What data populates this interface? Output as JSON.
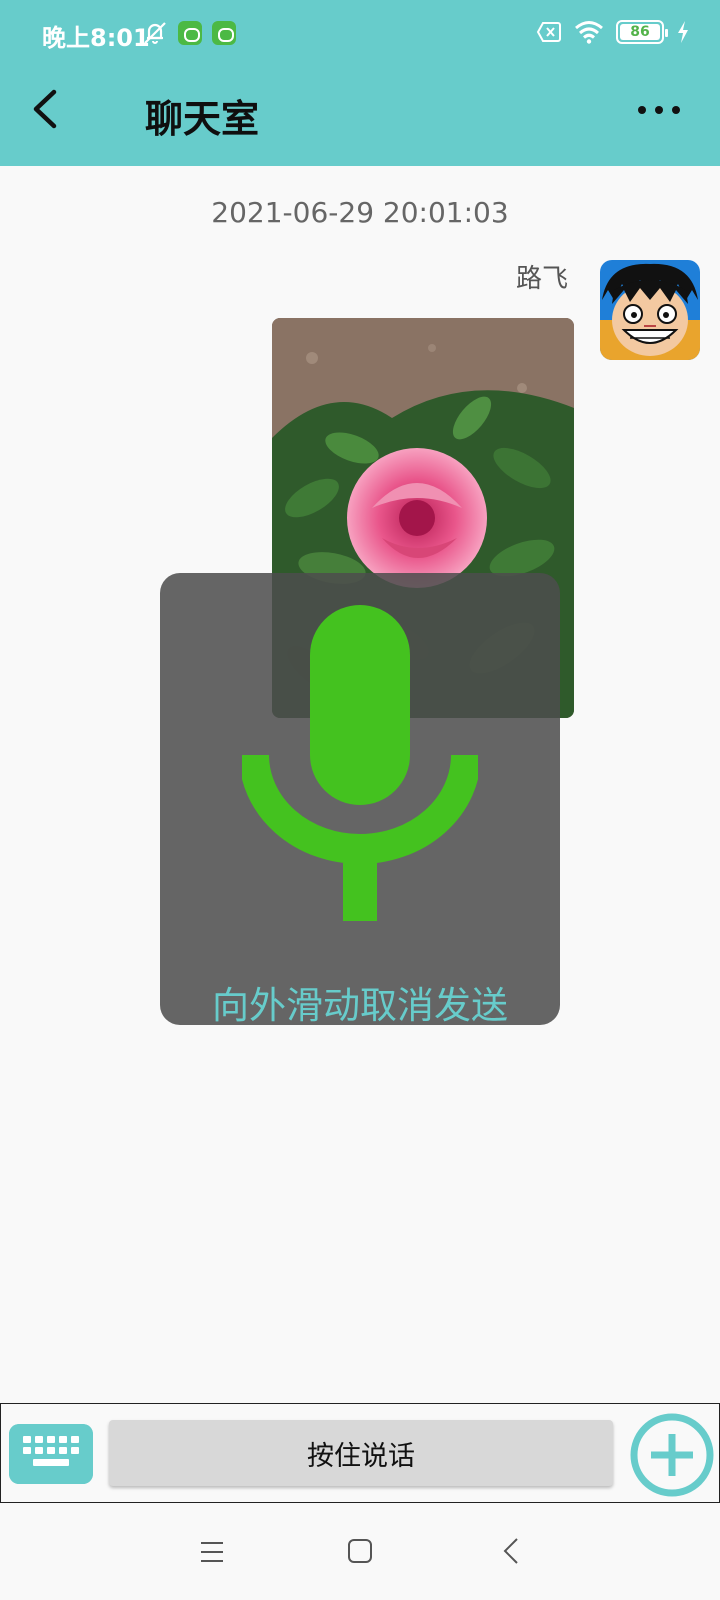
{
  "status_bar": {
    "time": "晚上8:01",
    "battery": "86",
    "icons": [
      "bell-off-icon",
      "app-badge-icon",
      "app-badge-icon",
      "sim-off-icon",
      "wifi-icon",
      "battery-icon",
      "charging-bolt-icon"
    ]
  },
  "header": {
    "title": "聊天室",
    "back_icon": "chevron-left-icon",
    "more_icon": "more-dots-icon"
  },
  "chat": {
    "timestamp": "2021-06-29 20:01:03",
    "messages": [
      {
        "sender": "路飞",
        "type": "image",
        "image_subject": "pink rose among green leaves"
      }
    ]
  },
  "voice_overlay": {
    "hint": "向外滑动取消发送",
    "icon": "microphone-icon"
  },
  "input_bar": {
    "hold_to_talk": "按住说话",
    "keyboard_icon": "keyboard-icon",
    "plus_icon": "plus-circle-icon"
  },
  "nav_bar": {
    "icons": [
      "menu-icon",
      "home-icon",
      "back-icon"
    ]
  },
  "colors": {
    "accent": "#67cccb",
    "mic_green": "#44c21f",
    "overlay": "#5a5a5a",
    "background": "#f9f9f9"
  }
}
